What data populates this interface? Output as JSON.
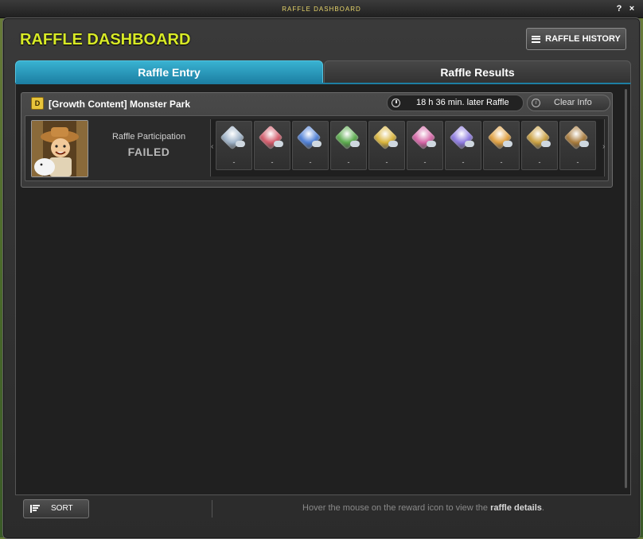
{
  "window": {
    "title": "RAFFLE DASHBOARD",
    "help_label": "?",
    "close_label": "×"
  },
  "header": {
    "title": "RAFFLE DASHBOARD",
    "history_button": "RAFFLE HISTORY"
  },
  "tabs": [
    {
      "label": "Raffle Entry",
      "active": true
    },
    {
      "label": "Raffle Results",
      "active": false
    }
  ],
  "raffle": {
    "badge": "D",
    "title": "[Growth Content] Monster Park",
    "timer": "18 h 36 min. later Raffle",
    "clear_button": "Clear Info",
    "participation_label": "Raffle Participation",
    "participation_status": "FAILED",
    "rewards": [
      {
        "icon": "silver-gem-icon",
        "qty": "-",
        "color": "#9fb3c8"
      },
      {
        "icon": "red-gem-icon",
        "qty": "-",
        "color": "#d35a6a"
      },
      {
        "icon": "blue-gem-icon",
        "qty": "-",
        "color": "#4e7fd6"
      },
      {
        "icon": "green-gem-icon",
        "qty": "-",
        "color": "#5aab4c"
      },
      {
        "icon": "yellow-gem-icon",
        "qty": "-",
        "color": "#d9b43b"
      },
      {
        "icon": "pink-gem-icon",
        "qty": "-",
        "color": "#d565a6"
      },
      {
        "icon": "violet-gem-icon",
        "qty": "-",
        "color": "#8d7ae0"
      },
      {
        "icon": "rainbow-gem-icon",
        "qty": "-",
        "color": "#e0a040"
      },
      {
        "icon": "gold-coin-pile-icon",
        "qty": "-",
        "color": "#caa040"
      },
      {
        "icon": "bronze-coin-pile-icon",
        "qty": "-",
        "color": "#a87a3a"
      }
    ]
  },
  "footer": {
    "sort_button": "SORT",
    "hint_prefix": "Hover the mouse on the reward icon to view the",
    "hint_bold": "raffle details",
    "hint_suffix": "."
  }
}
